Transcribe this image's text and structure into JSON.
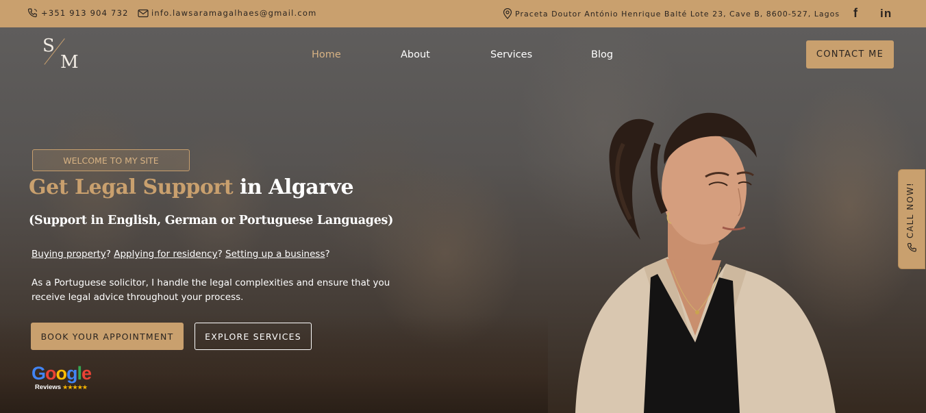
{
  "topbar": {
    "phone": "+351 913 904 732",
    "email": "info.lawsaramagalhaes@gmail.com",
    "address": "Praceta Doutor António Henrique Balté Lote 23, Cave B, 8600-527, Lagos",
    "social": [
      {
        "name": "facebook-icon",
        "glyph": "f"
      },
      {
        "name": "linkedin-icon",
        "glyph": "in"
      }
    ]
  },
  "logo": {
    "s": "S",
    "m": "M"
  },
  "nav": {
    "home": "Home",
    "about": "About",
    "services": "Services",
    "blog": "Blog"
  },
  "contact_button": "CONTACT ME",
  "hero": {
    "welcome": "WELCOME TO MY SITE",
    "headline_gold": "Get Legal Support",
    "headline_white": " in Algarve",
    "subheadline": "(Support in English, German or Portuguese Languages)",
    "q1": "Buying property",
    "q2": "Applying for residency",
    "q3": "Setting up a business",
    "sep": "? ",
    "end": "?",
    "description": "As a Portuguese solicitor, I handle the legal complexities and ensure that you receive legal advice throughout your process.",
    "book_button": "BOOK YOUR APPOINTMENT",
    "explore_button": "EXPLORE SERVICES"
  },
  "google": {
    "letters": [
      "G",
      "o",
      "o",
      "g",
      "l",
      "e"
    ],
    "letter_colors": [
      "#4285F4",
      "#EA4335",
      "#FBBC05",
      "#4285F4",
      "#34A853",
      "#EA4335"
    ],
    "reviews": "Reviews",
    "stars": "★★★★★"
  },
  "call_now": "CALL NOW!",
  "colors": {
    "accent": "#c9a06e",
    "accent_light": "#d8b384",
    "text_dark": "#2a2420"
  }
}
